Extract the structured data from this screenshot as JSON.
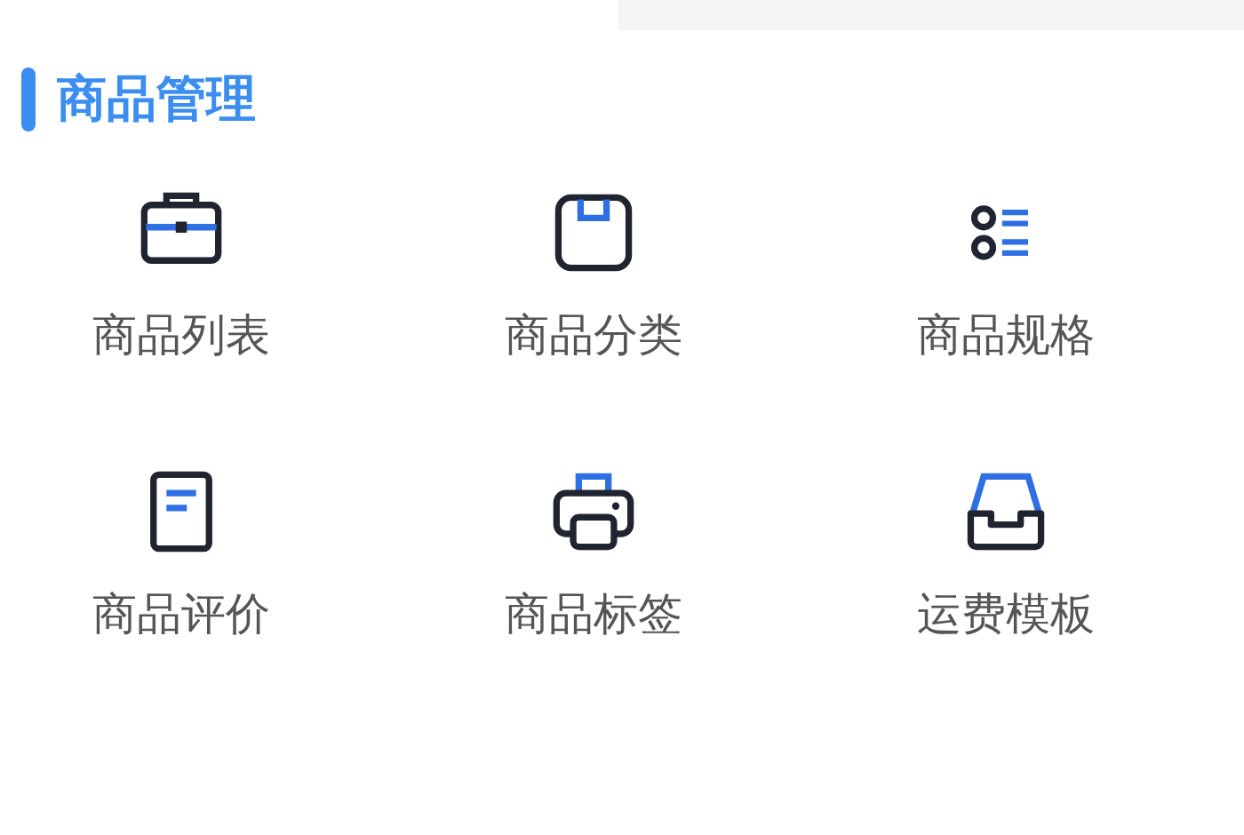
{
  "section": {
    "title": "商品管理"
  },
  "items": [
    {
      "label": "商品列表",
      "kind": "briefcase"
    },
    {
      "label": "商品分类",
      "kind": "box"
    },
    {
      "label": "商品规格",
      "kind": "list"
    },
    {
      "label": "商品评价",
      "kind": "document"
    },
    {
      "label": "商品标签",
      "kind": "printer"
    },
    {
      "label": "运费模板",
      "kind": "tray"
    }
  ]
}
